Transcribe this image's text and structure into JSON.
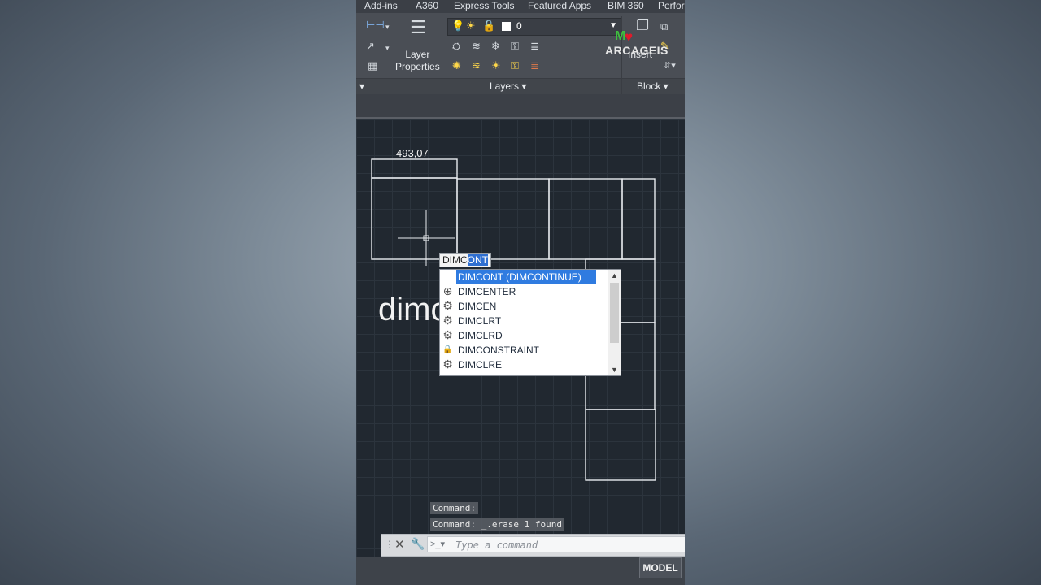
{
  "ribbon": {
    "tabs": [
      "Add-ins",
      "A360",
      "Express Tools",
      "Featured Apps",
      "BIM 360",
      "Perfor"
    ],
    "layer_properties": [
      "Layer",
      "Properties"
    ],
    "layer_value": "0",
    "insert_label": "Insert",
    "brand": "ARCAGEIS",
    "panels": [
      "Layers ▾",
      "Block ▾"
    ]
  },
  "drawing": {
    "dimension_value": "493,07",
    "overlay_text": "dimc"
  },
  "command_input": {
    "typed_prefix": "DIMC",
    "typed_highlight": "ONT"
  },
  "autocomplete": {
    "items": [
      {
        "label": "DIMCONT (DIMCONTINUE)",
        "icon": "none",
        "selected": true
      },
      {
        "label": "DIMCENTER",
        "icon": "center-mark-icon",
        "selected": false
      },
      {
        "label": "DIMCEN",
        "icon": "gear-icon",
        "selected": false
      },
      {
        "label": "DIMCLRT",
        "icon": "gear-icon",
        "selected": false
      },
      {
        "label": "DIMCLRD",
        "icon": "gear-icon",
        "selected": false
      },
      {
        "label": "DIMCONSTRAINT",
        "icon": "lock-icon",
        "selected": false
      },
      {
        "label": "DIMCLRE",
        "icon": "gear-icon",
        "selected": false
      }
    ]
  },
  "history": [
    "Command:",
    "Command: _.erase 1 found"
  ],
  "command_line": {
    "placeholder": "Type a command"
  },
  "status": {
    "model": "MODEL"
  }
}
